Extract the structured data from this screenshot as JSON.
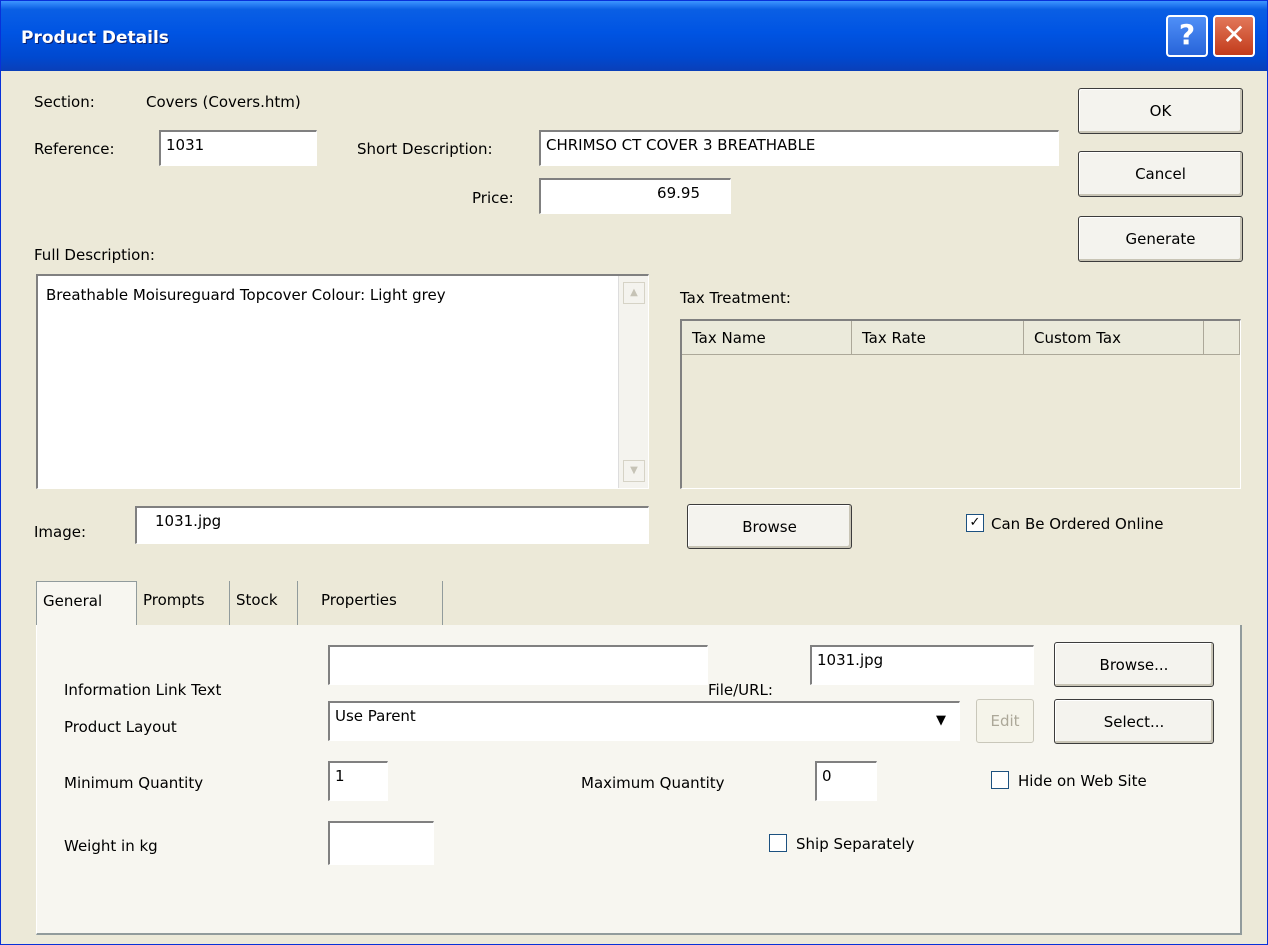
{
  "window": {
    "title": "Product Details",
    "help_glyph": "?",
    "close_glyph": "✕"
  },
  "form": {
    "section_label": "Section:",
    "section_value": "Covers (Covers.htm)",
    "reference_label": "Reference:",
    "reference_value": "1031",
    "short_desc_label": "Short Description:",
    "short_desc_value": "CHRIMSO CT COVER 3 BREATHABLE",
    "price_label": "Price:",
    "price_value": "69.95",
    "full_desc_label": "Full Description:",
    "full_desc_value": "Breathable Moisureguard Topcover Colour: Light grey",
    "image_label": "Image:",
    "image_value": "1031.jpg",
    "tax_treatment_label": "Tax Treatment:",
    "tax_headers": [
      "Tax Name",
      "Tax Rate",
      "Custom Tax"
    ],
    "browse_label": "Browse",
    "online_label": "Can Be Ordered Online",
    "online_checked": "✓"
  },
  "buttons": {
    "ok": "OK",
    "cancel": "Cancel",
    "generate": "Generate"
  },
  "tabs": [
    "General",
    "Prompts",
    "Stock",
    "Properties"
  ],
  "general": {
    "info_link_label": "Information Link Text",
    "info_link_value": "",
    "file_url_label": "File/URL:",
    "file_url_value": "1031.jpg",
    "browse_label": "Browse...",
    "layout_label": "Product Layout",
    "layout_value": "Use Parent",
    "edit_label": "Edit",
    "select_label": "Select...",
    "min_qty_label": "Minimum Quantity",
    "min_qty_value": "1",
    "max_qty_label": "Maximum Quantity",
    "max_qty_value": "0",
    "hide_label": "Hide on Web Site",
    "weight_label": "Weight in kg",
    "weight_value": "",
    "ship_label": "Ship Separately"
  }
}
